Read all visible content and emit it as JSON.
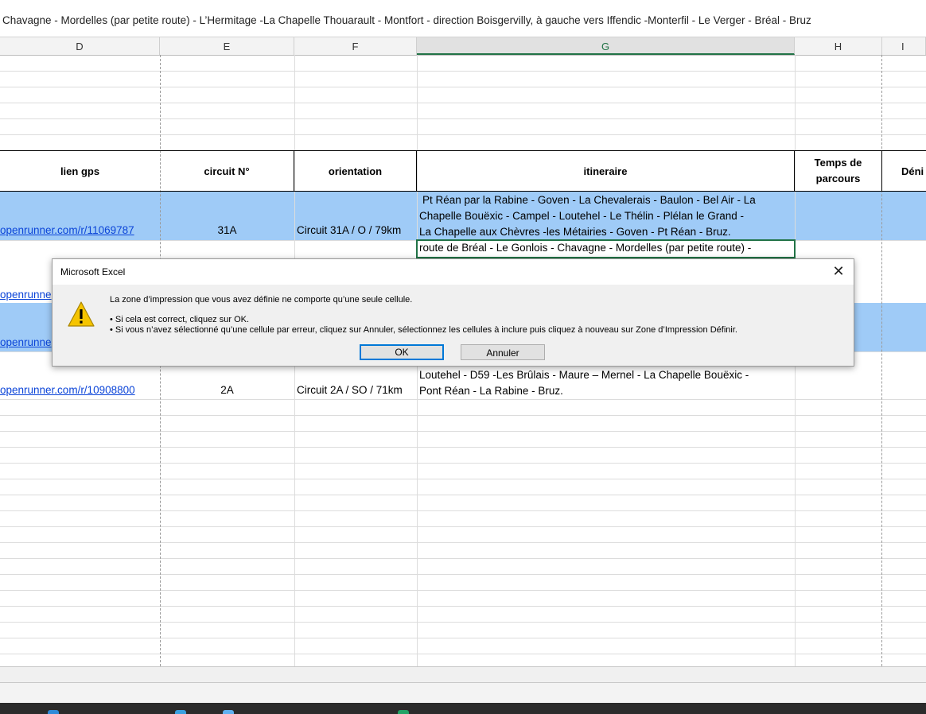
{
  "formula_bar": {
    "text": "Chavagne - Mordelles (par petite route) - L’Hermitage -La Chapelle Thouarault - Montfort - direction Boisgervilly, à gauche vers Iffendic -Monterfil - Le Verger - Bréal - Bruz"
  },
  "columns": [
    "D",
    "E",
    "F",
    "G",
    "H",
    "I"
  ],
  "selected_column": "G",
  "table_headers": {
    "lien_gps": "lien gps",
    "circuit": "circuit N°",
    "orientation": "orientation",
    "itineraire": "itineraire",
    "temps_1": "Temps de",
    "temps_2": "parcours",
    "deniv": "Déni"
  },
  "rows": [
    {
      "link": "openrunner.com/r/11069787",
      "circuit": "31A",
      "orientation": "Circuit 31A / O / 79km",
      "itin": [
        "Pt Réan par la Rabine - Goven - La Chevalerais - Baulon - Bel Air - La",
        "Chapelle Bouëxic - Campel - Loutehel - Le Thélin - Plélan le Grand -",
        "La Chapelle aux Chèvres -les Métairies - Goven - Pt Réan - Bruz."
      ]
    },
    {
      "link": "openrunne",
      "itin": [
        "route de Bréal - Le Gonlois - Chavagne - Mordelles (par petite route) -"
      ]
    },
    {
      "link": "openrunne"
    },
    {
      "link": "openrunner.com/r/10908800",
      "circuit": "2A",
      "orientation": "Circuit 2A / SO / 71km",
      "itin": [
        "Loutehel - D59 -Les Brûlais - Maure – Mernel - La Chapelle Bouëxic -",
        "Pont Réan - La Rabine - Bruz."
      ]
    }
  ],
  "dialog": {
    "title": "Microsoft Excel",
    "close_symbol": "✕",
    "icon": "warning-icon",
    "message_1": "La zone d’impression que vous avez définie ne comporte qu’une seule cellule.",
    "message_2": "• Si cela est correct, cliquez sur OK.",
    "message_3": "• Si vous n’avez sélectionné qu’une cellule par erreur, cliquez sur Annuler, sélectionnez les cellules à inclure puis cliquez à nouveau sur Zone d’Impression Définir.",
    "ok_label": "OK",
    "cancel_label": "Annuler"
  },
  "colors": {
    "band": "#9fcbf7",
    "link": "#0b44d8",
    "selection": "#217346",
    "warning": "#f5c400"
  }
}
